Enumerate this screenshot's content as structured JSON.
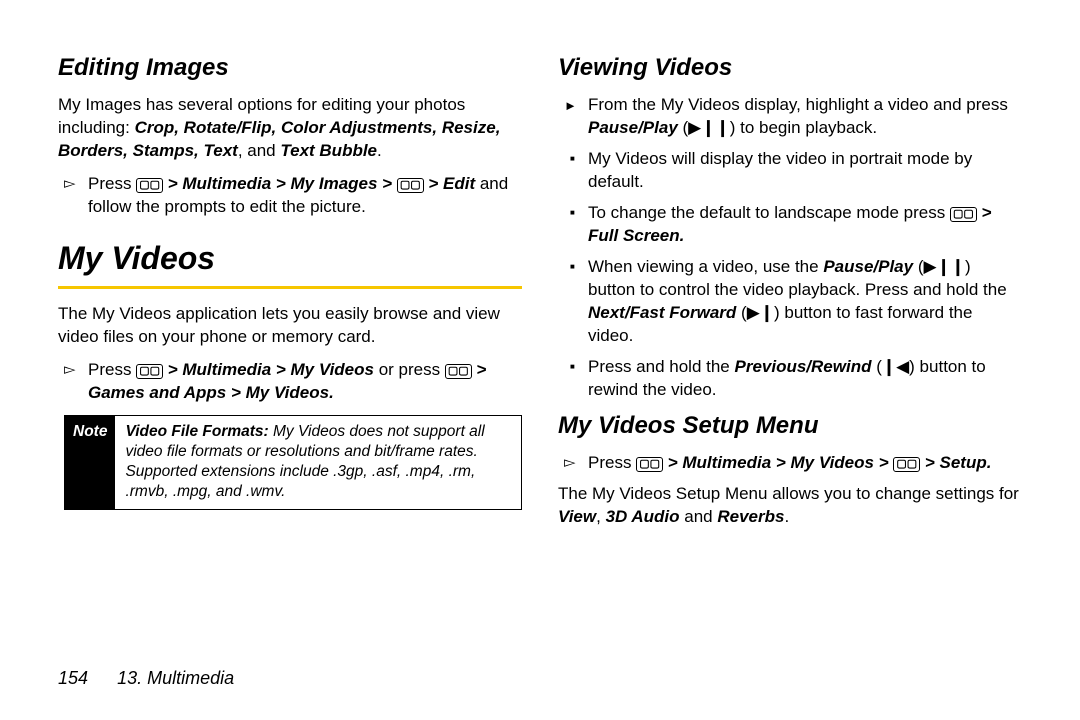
{
  "left": {
    "h_editing": "Editing Images",
    "p_editing_1a": "My Images has several options for editing your photos including: ",
    "p_editing_1b": "Crop, Rotate/Flip, Color Adjustments, Resize, Borders, Stamps, Text",
    "p_editing_1c": ", and ",
    "p_editing_1d": "Text Bubble",
    "p_editing_1e": ".",
    "li_edit_a": "Press ",
    "li_edit_b": " > Multimedia > My Images > ",
    "li_edit_c": " > Edit",
    "li_edit_d": " and follow the prompts to edit the picture.",
    "h_myvideos": "My Videos",
    "p_myvideos_intro": "The My Videos application lets you easily browse and view video files on your phone or memory card.",
    "li_mv_a": "Press ",
    "li_mv_b": " > Multimedia > My Videos",
    "li_mv_c": " or press ",
    "li_mv_d": " > Games and Apps > My Videos.",
    "note_label": "Note",
    "note_body_a": "Video File Formats: ",
    "note_body_b": "My Videos does not support all video file formats or resolutions and bit/frame rates. Supported extensions include .3gp, .asf, .mp4, .rm, .rmvb, .mpg, and .wmv."
  },
  "right": {
    "h_viewing": "Viewing Videos",
    "li_v1_a": "From the My Videos display, highlight a video and press ",
    "li_v1_b": "Pause/Play",
    "li_v1_c": " (▶❙❙) to begin playback.",
    "li_v2": "My Videos will display the video in portrait mode by default.",
    "li_v3_a": "To change the default to landscape mode press ",
    "li_v3_b": " > Full Screen.",
    "li_v4_a": "When viewing a video, use the ",
    "li_v4_b": "Pause/Play",
    "li_v4_c": " (▶❙❙) button to control the video playback. Press and hold the ",
    "li_v4_d": "Next/Fast Forward",
    "li_v4_e": " (▶❙) button to fast forward the video.",
    "li_v5_a": "Press and hold the ",
    "li_v5_b": "Previous/Rewind",
    "li_v5_c": " (❙◀) button to rewind the video.",
    "h_setup": "My Videos Setup Menu",
    "li_s1_a": "Press ",
    "li_s1_b": " > Multimedia > My Videos > ",
    "li_s1_c": " > Setup.",
    "p_setup_a": "The My Videos Setup Menu allows you to change settings for ",
    "p_setup_b": "View",
    "p_setup_c": ", ",
    "p_setup_d": "3D Audio",
    "p_setup_e": " and ",
    "p_setup_f": "Reverbs",
    "p_setup_g": "."
  },
  "footer": {
    "page": "154",
    "section": "13. Multimedia"
  },
  "keycap": "▢▢"
}
